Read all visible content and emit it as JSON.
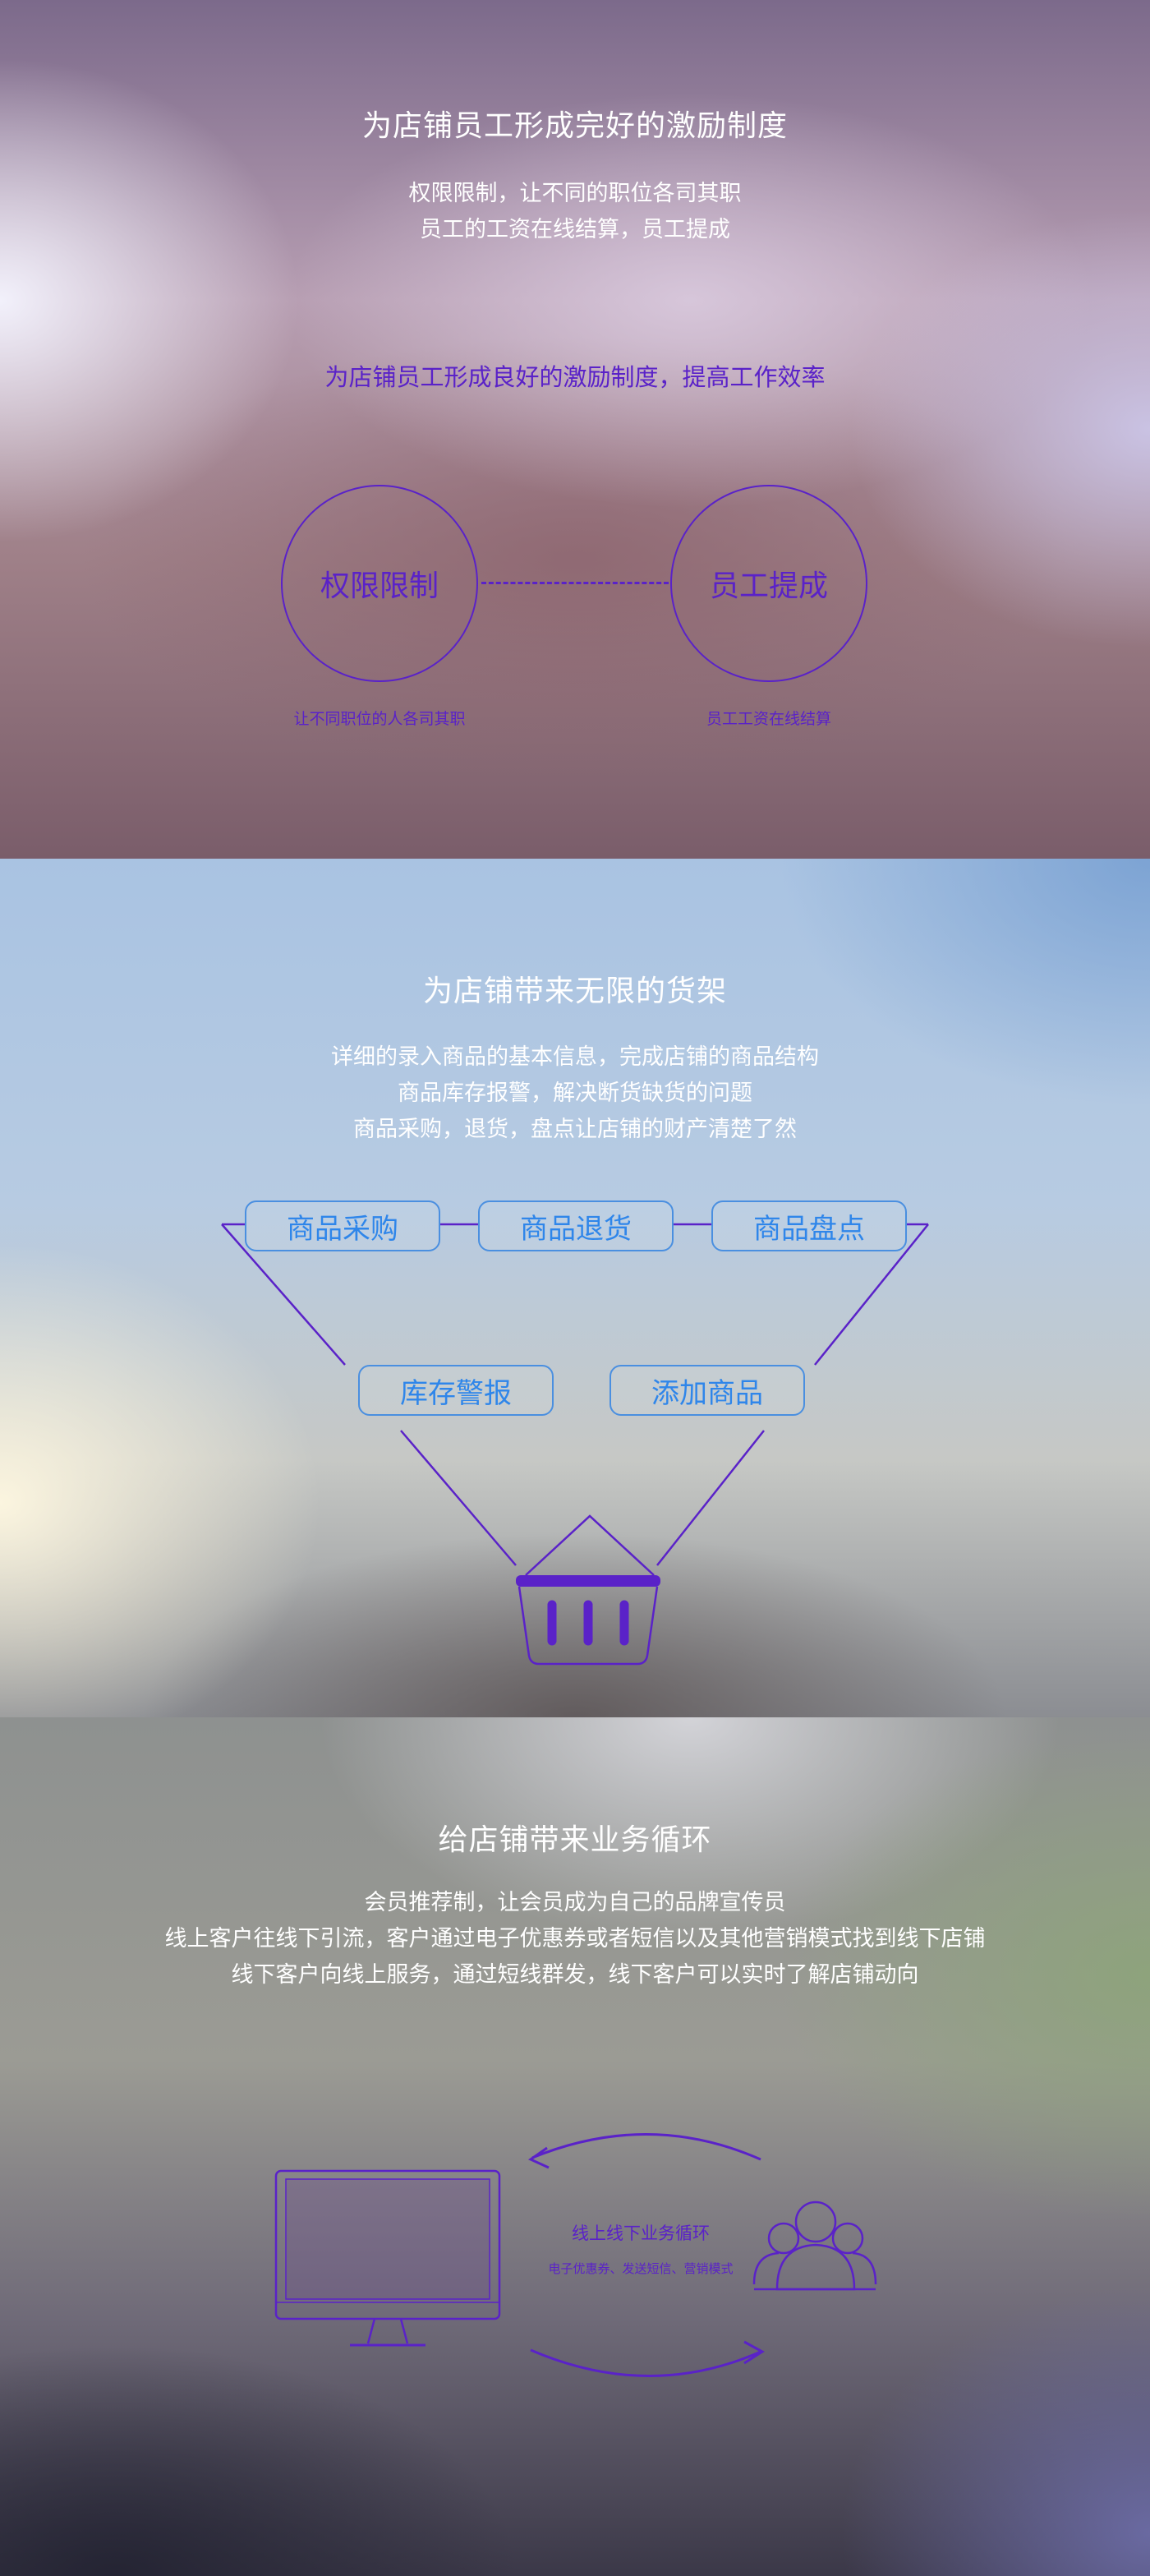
{
  "section1": {
    "title": "为店铺员工形成完好的激励制度",
    "desc_lines": [
      "权限限制，让不同的职位各司其职",
      "员工的工资在线结算，员工提成"
    ],
    "subtitle": "为店铺员工形成良好的激励制度，提高工作效率",
    "circles": [
      {
        "label": "权限限制",
        "caption": "让不同职位的人各司其职"
      },
      {
        "label": "员工提成",
        "caption": "员工工资在线结算"
      }
    ]
  },
  "section2": {
    "title": "为店铺带来无限的货架",
    "desc_lines": [
      "详细的录入商品的基本信息，完成店铺的商品结构",
      "商品库存报警，解决断货缺货的问题",
      "商品采购，退货，盘点让店铺的财产清楚了然"
    ],
    "top_pills": [
      "商品采购",
      "商品退货",
      "商品盘点"
    ],
    "bottom_pills": [
      "库存警报",
      "添加商品"
    ],
    "icon": "shopping-basket-icon"
  },
  "section3": {
    "title": "给店铺带来业务循环",
    "desc_lines": [
      "会员推荐制，让会员成为自己的品牌宣传员",
      "线上客户往线下引流，客户通过电子优惠券或者短信以及其他营销模式找到线下店铺",
      "线下客户向线上服务，通过短线群发，线下客户可以实时了解店铺动向"
    ],
    "loop_title": "线上线下业务循环",
    "loop_sub": "电子优惠券、发送短信、营销模式",
    "icons": [
      "monitor-icon",
      "users-icon",
      "arrow-left-icon",
      "arrow-right-icon"
    ]
  },
  "colors": {
    "accent": "#5a22c8",
    "pill_blue": "#2f86ea"
  }
}
